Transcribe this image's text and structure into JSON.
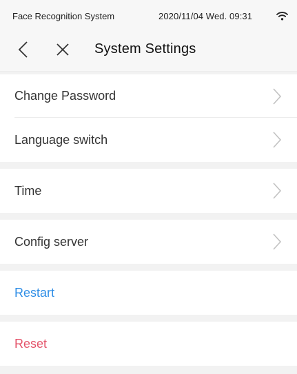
{
  "status_bar": {
    "app_name": "Face Recognition System",
    "datetime": "2020/11/04  Wed.  09:31",
    "wifi_icon": "wifi-icon"
  },
  "nav": {
    "back_icon": "chevron-left-icon",
    "close_icon": "close-icon",
    "title": "System Settings"
  },
  "menu": {
    "change_password": "Change Password",
    "language_switch": "Language switch",
    "time": "Time",
    "config_server": "Config server",
    "restart": "Restart",
    "reset": "Reset",
    "chevron_icon": "chevron-right-icon"
  },
  "colors": {
    "background": "#f2f2f2",
    "row_background": "#ffffff",
    "restart_blue": "#2f8ee6",
    "reset_red": "#e4536a"
  }
}
